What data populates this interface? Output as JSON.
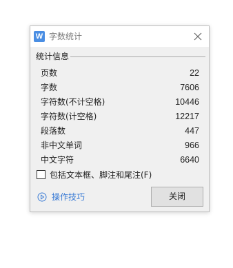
{
  "window": {
    "app_icon_letter": "W",
    "title": "字数统计",
    "close_icon": "close-icon"
  },
  "group": {
    "header": "统计信息"
  },
  "stats": [
    {
      "label": "页数",
      "value": "22"
    },
    {
      "label": "字数",
      "value": "7606"
    },
    {
      "label": "字符数(不计空格)",
      "value": "10446"
    },
    {
      "label": "字符数(计空格)",
      "value": "12217"
    },
    {
      "label": "段落数",
      "value": "447"
    },
    {
      "label": "非中文单词",
      "value": "966"
    },
    {
      "label": "中文字符",
      "value": "6640"
    }
  ],
  "checkbox": {
    "label": "包括文本框、脚注和尾注(F)",
    "checked": false
  },
  "tips": {
    "label": "操作技巧",
    "icon": "play-circle-icon"
  },
  "close_button": {
    "label": "关闭"
  },
  "colors": {
    "accent": "#3a7bd5",
    "app_icon": "#4a8ee3",
    "dialog_bg": "#f0f0f0"
  }
}
